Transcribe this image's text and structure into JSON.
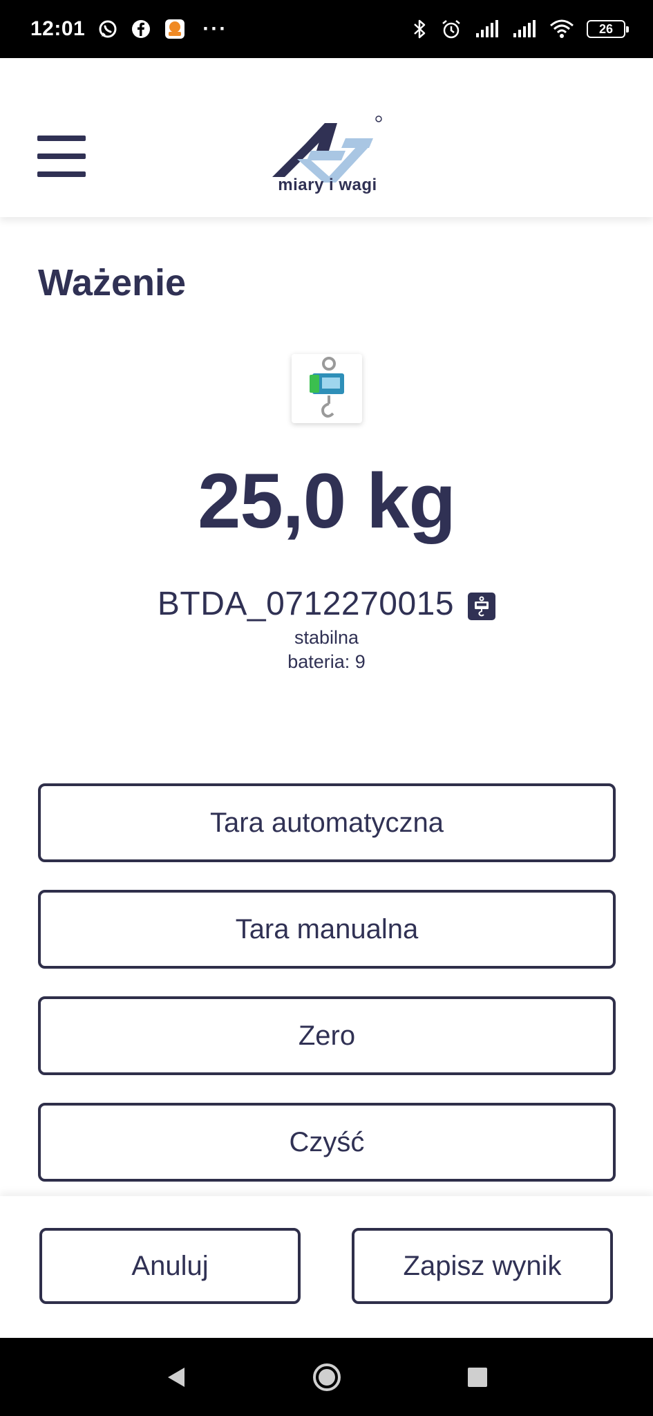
{
  "status_bar": {
    "time": "12:01",
    "left_icons": [
      "whatsapp-icon",
      "facebook-icon",
      "app-notification-icon"
    ],
    "more": "···",
    "right_icons": [
      "bluetooth-icon",
      "alarm-icon",
      "signal-icon",
      "signal-icon",
      "wifi-icon"
    ],
    "battery": "26"
  },
  "header": {
    "menu_icon": "hamburger-menu-icon",
    "logo_text": "miary i wagi",
    "brand_colors": {
      "dark": "#303154",
      "light": "#a9c6e3"
    }
  },
  "main": {
    "title": "Ważenie",
    "weight": "25,0 kg",
    "device_id": "BTDA_0712270015",
    "device_icon": "crane-scale-icon",
    "status": "stabilna",
    "battery": "bateria: 9"
  },
  "actions": {
    "auto_tare": "Tara automatyczna",
    "manual_tare": "Tara manualna",
    "zero": "Zero",
    "clear": "Czyść"
  },
  "footer": {
    "cancel": "Anuluj",
    "save": "Zapisz wynik"
  },
  "nav_bar": {
    "icons": [
      "back-icon",
      "home-icon",
      "recents-icon"
    ]
  },
  "colors": {
    "primary": "#303154",
    "button_border": "#2f2f4a",
    "status_bar": "#000000"
  }
}
